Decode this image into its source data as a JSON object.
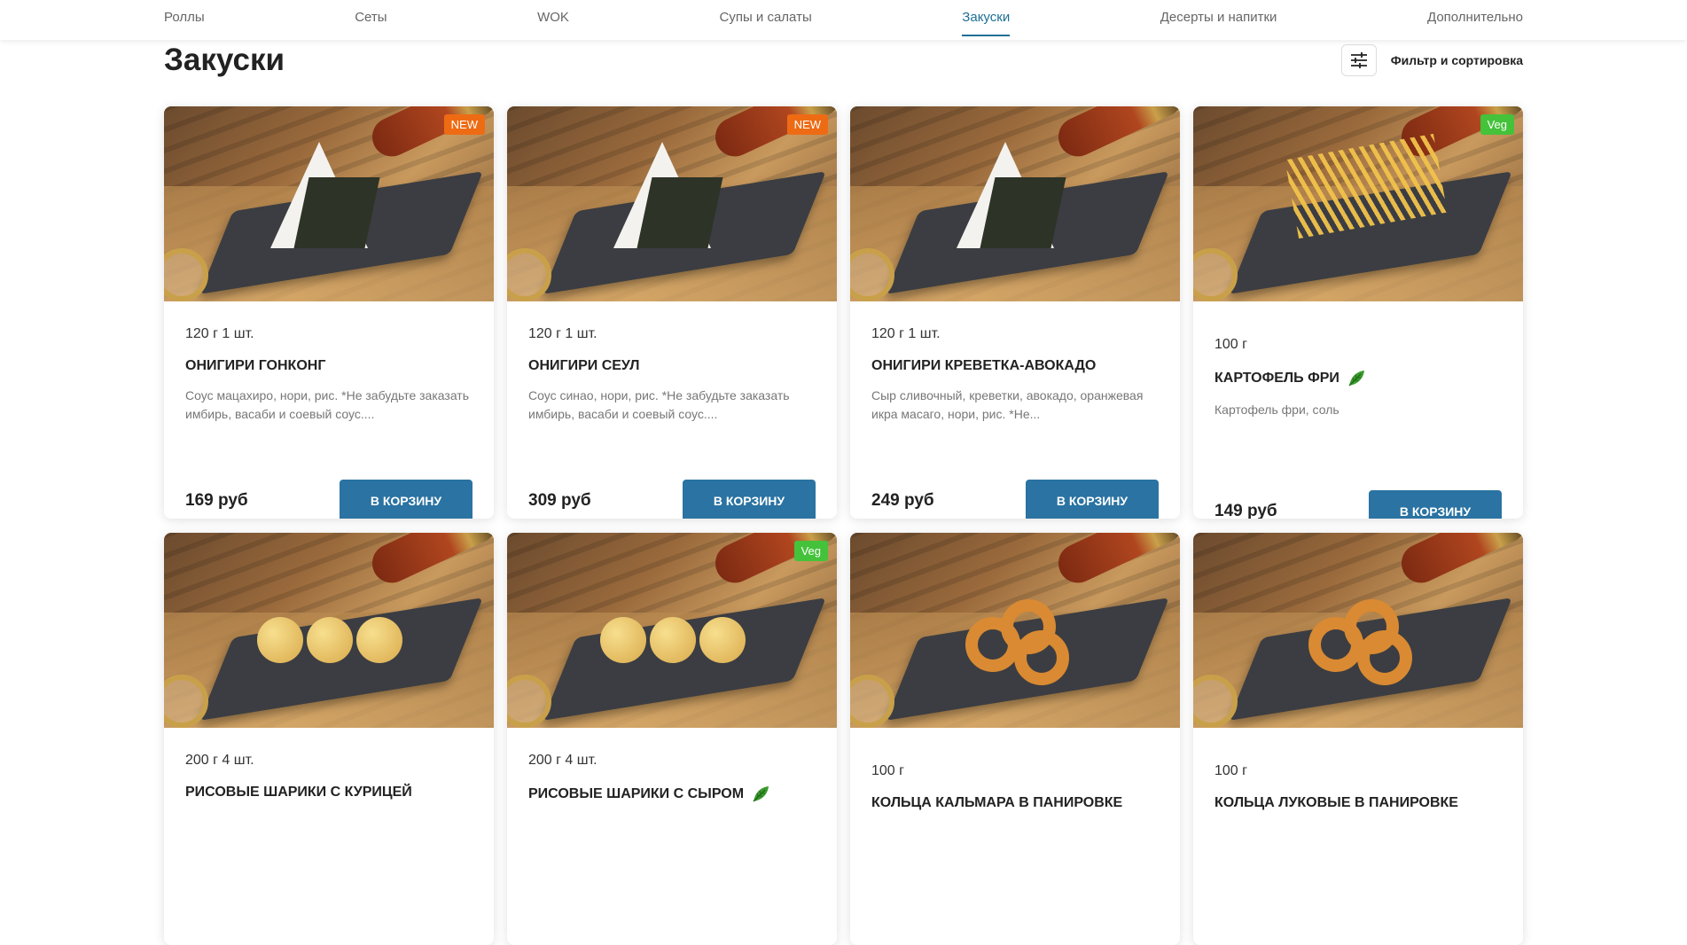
{
  "nav": {
    "items": [
      "Роллы",
      "Сеты",
      "WOK",
      "Супы и салаты",
      "Закуски",
      "Десерты и напитки",
      "Дополнительно"
    ],
    "active": "Закуски"
  },
  "page": {
    "title": "Закуски"
  },
  "filter": {
    "label": "Фильтр и сортировка",
    "icon": "sliders-icon"
  },
  "products": [
    {
      "weight": "120 г 1 шт.",
      "name": "ОНИГИРИ ГОНКОНГ",
      "desc": "Соус мацахиро, нори, рис. *Не забудьте заказать имбирь, васаби и соевый соус....",
      "price": "169 руб",
      "badge": "NEW",
      "veg": false,
      "button": "В КОРЗИНУ",
      "food": "onigiri"
    },
    {
      "weight": "120 г 1 шт.",
      "name": "ОНИГИРИ СЕУЛ",
      "desc": "Соус синао, нори, рис. *Не забудьте заказать имбирь, васаби и соевый соус....",
      "price": "309 руб",
      "badge": "NEW",
      "veg": false,
      "button": "В КОРЗИНУ",
      "food": "onigiri"
    },
    {
      "weight": "120 г 1 шт.",
      "name": "ОНИГИРИ КРЕВЕТКА-АВОКАДО",
      "desc": "Сыр сливочный, креветки, авокадо, оранжевая икра масаго, нори, рис. *Не...",
      "price": "249 руб",
      "badge": "",
      "veg": false,
      "button": "В КОРЗИНУ",
      "food": "onigiri"
    },
    {
      "weight": "100 г",
      "name": "КАРТОФЕЛЬ ФРИ",
      "desc": "Картофель фри, соль",
      "price": "149 руб",
      "badge": "Veg",
      "veg": true,
      "button": "В КОРЗИНУ",
      "food": "fries"
    },
    {
      "weight": "200 г 4 шт.",
      "name": "РИСОВЫЕ ШАРИКИ С КУРИЦЕЙ",
      "desc": "",
      "price": "",
      "badge": "",
      "veg": false,
      "button": "",
      "food": "balls"
    },
    {
      "weight": "200 г 4 шт.",
      "name": "РИСОВЫЕ ШАРИКИ С СЫРОМ",
      "desc": "",
      "price": "",
      "badge": "Veg",
      "veg": true,
      "button": "",
      "food": "balls"
    },
    {
      "weight": "100 г",
      "name": "КОЛЬЦА КАЛЬМАРА В ПАНИРОВКЕ",
      "desc": "",
      "price": "",
      "badge": "",
      "veg": false,
      "button": "",
      "food": "rings"
    },
    {
      "weight": "100 г",
      "name": "КОЛЬЦА ЛУКОВЫЕ В ПАНИРОВКЕ",
      "desc": "",
      "price": "",
      "badge": "",
      "veg": false,
      "button": "",
      "food": "rings"
    }
  ],
  "colors": {
    "accent": "#2a73a2",
    "active_nav": "#1e6f95",
    "badge_new": "#ee6b14",
    "badge_veg": "#44c23a",
    "leaf": "#3a9a2e"
  }
}
